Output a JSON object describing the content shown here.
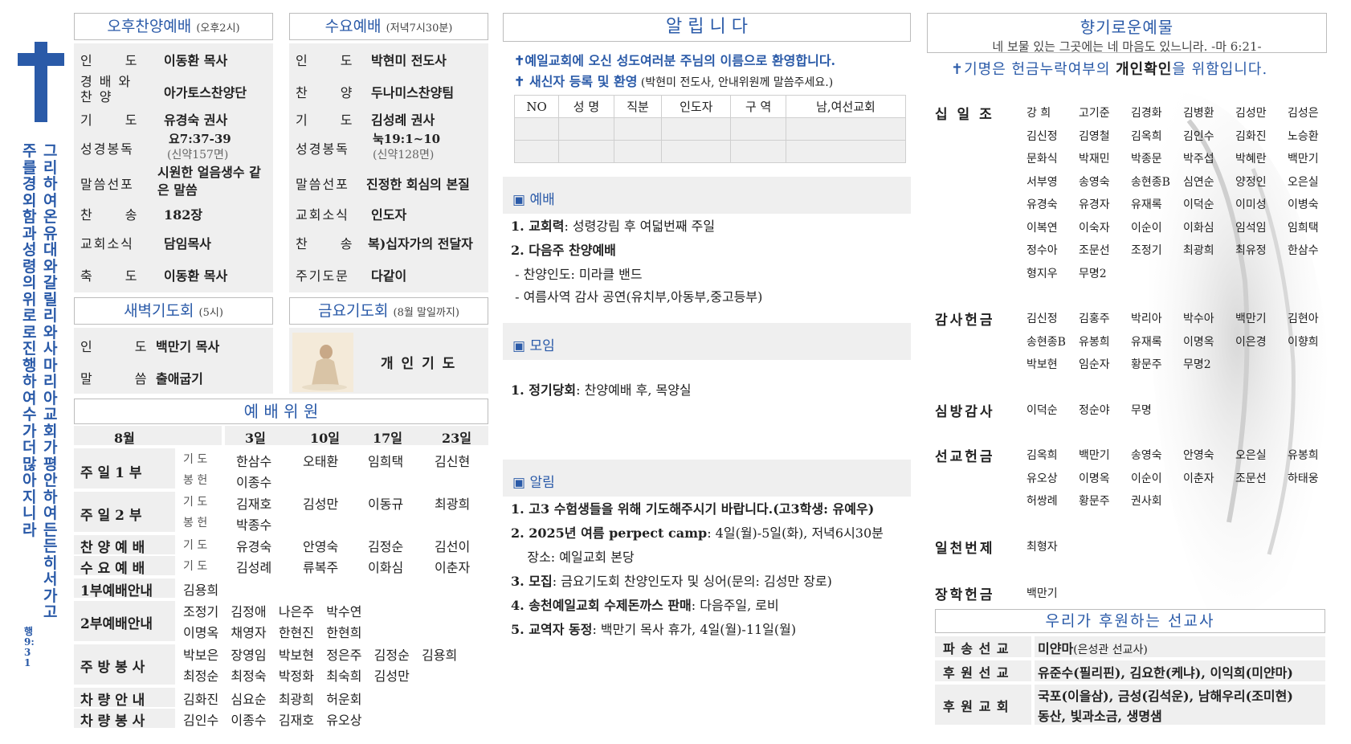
{
  "sidebar": {
    "verse_col1": "그리하여 온 유대와 갈릴리와 사마리아 교회가 평안하여 든든히 서 가고",
    "verse_col2": "주를 경외함과 성령의 위로로 진행하여 수가 더 많아지니라",
    "verse_ref": "행 9:31"
  },
  "afternoon": {
    "title": "오후찬양예배",
    "time": "(오후2시)",
    "rows": [
      {
        "label": "인 도",
        "value": "이동환 목사"
      },
      {
        "label": "경배와찬양",
        "value": "아가토스찬양단"
      },
      {
        "label": "기 도",
        "value": "유경숙 권사"
      },
      {
        "label": "성경봉독",
        "value": "요7:37-39",
        "sub": "(신약157면)"
      },
      {
        "label": "말씀선포",
        "value": "시원한 얼음생수 같은 말씀"
      },
      {
        "label": "찬 송",
        "value": "182장"
      },
      {
        "label": "교회소식",
        "value": "담임목사"
      },
      {
        "label": "축 도",
        "value": "이동환 목사"
      }
    ]
  },
  "wednesday": {
    "title": "수요예배",
    "time": "(저녁7시30분)",
    "rows": [
      {
        "label": "인 도",
        "value": "박현미 전도사"
      },
      {
        "label": "찬 양",
        "value": "두나미스찬양팀"
      },
      {
        "label": "기 도",
        "value": "김성례 권사"
      },
      {
        "label": "성경봉독",
        "value": "눅19:1~10",
        "sub": "(신약128면)"
      },
      {
        "label": "말씀선포",
        "value": "진정한 회심의 본질"
      },
      {
        "label": "교회소식",
        "value": "인도자"
      },
      {
        "label": "찬 송",
        "value": "복)십자가의 전달자"
      },
      {
        "label": "주기도문",
        "value": "다같이"
      }
    ]
  },
  "dawn": {
    "title": "새벽기도회",
    "time": "(5시)",
    "rows": [
      {
        "label": "인 도",
        "value": "백만기 목사"
      },
      {
        "label": "말 씀",
        "value": "출애굽기"
      }
    ]
  },
  "friday": {
    "title": "금요기도회",
    "time": "(8월 말일까지)",
    "content": "개 인 기 도"
  },
  "committee": {
    "title": "예 배 위 원",
    "month": "8월",
    "dates": [
      "3일",
      "10일",
      "17일",
      "23일"
    ],
    "rows": [
      {
        "name": "주 일 1 부",
        "sub1": "기 도",
        "sub1_vals": [
          "한삼수",
          "오태환",
          "임희택",
          "김신현"
        ],
        "sub2": "봉 헌",
        "sub2_vals": [
          "이종수"
        ]
      },
      {
        "name": "주 일 2 부",
        "sub1": "기 도",
        "sub1_vals": [
          "김재호",
          "김성만",
          "이동규",
          "최광희"
        ],
        "sub2": "봉 헌",
        "sub2_vals": [
          "박종수"
        ]
      },
      {
        "name": "찬 양 예 배",
        "sub1": "기 도",
        "sub1_vals": [
          "유경숙",
          "안영숙",
          "김정순",
          "김선이"
        ]
      },
      {
        "name": "수 요 예 배",
        "sub1": "기 도",
        "sub1_vals": [
          "김성례",
          "류복주",
          "이화심",
          "이춘자"
        ]
      },
      {
        "name": "1부예배안내",
        "line1": "김용희"
      },
      {
        "name": "2부예배안내",
        "line1": "조정기   김정애   나은주   박수연",
        "line2": "이명옥   채영자   한현진   한현희"
      },
      {
        "name": "주 방 봉 사",
        "line1": "박보은   장영임   박보현   정은주   김정순   김용희",
        "line2": "최정순   최정숙   박정화   최숙희   김성만"
      },
      {
        "name": "차 량 안 내",
        "line1": "김화진   심요순   최광희   허운회"
      },
      {
        "name": "차 량 봉 사",
        "line1": "김인수   이종수   김재호   유오상"
      }
    ]
  },
  "notice": {
    "title": "알 립 니 다",
    "welcome": "✝예일교회에 오신 성도여러분 주님의 이름으로 환영합니다.",
    "register_bold": "✝ 새신자 등록 및 환영",
    "register_rest": " (박현미 전도사, 안내위원께 말씀주세요.)",
    "table_headers": [
      "NO",
      "성 명",
      "직분",
      "인도자",
      "구 역",
      "남,여선교회"
    ],
    "worship_title": "▣ 예배",
    "worship_items": [
      {
        "bold": "1. 교회력",
        "rest": ": 성령강림 후 여덟번째 주일"
      },
      {
        "bold": "2. 다음주 찬양예배",
        "rest": ""
      },
      {
        "bold": "",
        "rest": " - 찬양인도: 미라클 밴드"
      },
      {
        "bold": "",
        "rest": " - 여름사역 감사 공연(유치부,아동부,중고등부)"
      }
    ],
    "meeting_title": "▣ 모임",
    "meeting_items": [
      {
        "bold": "1. 정기당회",
        "rest": ": 찬양예배 후, 목양실"
      }
    ],
    "info_title": "▣ 알림",
    "info_items": [
      {
        "bold": "1. 고3 수험생들을 위해 기도해주시기 바랍니다.(고3학생: 유예우)",
        "rest": ""
      },
      {
        "bold": "2. 2025년 여름 perpect camp",
        "rest": ": 4일(월)-5일(화), 저녁6시30분"
      },
      {
        "bold": "",
        "rest": "    장소: 예일교회 본당"
      },
      {
        "bold": "3. 모집",
        "rest": ": 금요기도회 찬양인도자 및 싱어(문의: 김성만 장로)"
      },
      {
        "bold": "4. 송천예일교회 수제돈까스 판매",
        "rest": ": 다음주일, 로비"
      },
      {
        "bold": "5. 교역자 동정",
        "rest": ": 백만기 목사 휴가, 4일(월)-11일(월)"
      }
    ]
  },
  "offering": {
    "title": "향기로운예물",
    "verse": "네 보물 있는 그곳에는 네 마음도 있느니라. -마 6:21-",
    "note_pre": "✝기명은 헌금누락여부의 ",
    "note_bold": "개인확인",
    "note_post": "을 위함입니다.",
    "groups": [
      {
        "label": "십 일 조",
        "names": [
          "강 희",
          "고기준",
          "김경화",
          "김병환",
          "김성만",
          "김성은",
          "김신정",
          "김영철",
          "김옥희",
          "김인수",
          "김화진",
          "노승환",
          "문화식",
          "박재민",
          "박종문",
          "박주섭",
          "박혜란",
          "백만기",
          "서부영",
          "송영숙",
          "송현종B",
          "심연순",
          "양정인",
          "오은실",
          "유경숙",
          "유경자",
          "유재록",
          "이덕순",
          "이미성",
          "이병숙",
          "이복연",
          "이숙자",
          "이순이",
          "이화심",
          "임석임",
          "임희택",
          "정수아",
          "조문선",
          "조정기",
          "최광희",
          "최유정",
          "한삼수",
          "형지우",
          "무명2"
        ]
      },
      {
        "label": "감사헌금",
        "names": [
          "김신정",
          "김홍주",
          "박리아",
          "박수아",
          "백만기",
          "김현아",
          "송현종B",
          "유봉희",
          "유재록",
          "이명옥",
          "이은경",
          "이향희",
          "박보현",
          "임순자",
          "황문주",
          "무명2"
        ]
      },
      {
        "label": "심방감사",
        "names": [
          "이덕순",
          "정순야",
          "무명"
        ]
      },
      {
        "label": "선교헌금",
        "names": [
          "김옥희",
          "백만기",
          "송영숙",
          "안영숙",
          "오은실",
          "유봉희",
          "유오상",
          "이명옥",
          "이순이",
          "이춘자",
          "조문선",
          "하태웅",
          "허쌍례",
          "황문주",
          "권사회"
        ]
      },
      {
        "label": "일천번제",
        "names": [
          "최형자"
        ]
      },
      {
        "label": "장학헌금",
        "names": [
          "백만기"
        ]
      }
    ]
  },
  "missionary": {
    "title": "우리가 후원하는 선교사",
    "rows": [
      {
        "label": "파 송 선 교",
        "value": "미얀마",
        "rest": "(은성관 선교사)"
      },
      {
        "label": "후 원 선 교",
        "value": "유준수(필리핀), 김요한(케냐), 이익희(미얀마)"
      },
      {
        "label": "후 원 교 회",
        "value": "국포(이을삼), 금성(김석운), 남해우리(조미현)",
        "value2": "동산, 빛과소금, 생명샘"
      }
    ]
  },
  "colors": {
    "accent": "#2a5aa8",
    "cross": "#2a5aa8",
    "cell_bg": "#efefef"
  },
  "icons": {
    "cross": "cross-icon",
    "praying": "praying-figure-image",
    "hands": "praying-hands-image"
  }
}
